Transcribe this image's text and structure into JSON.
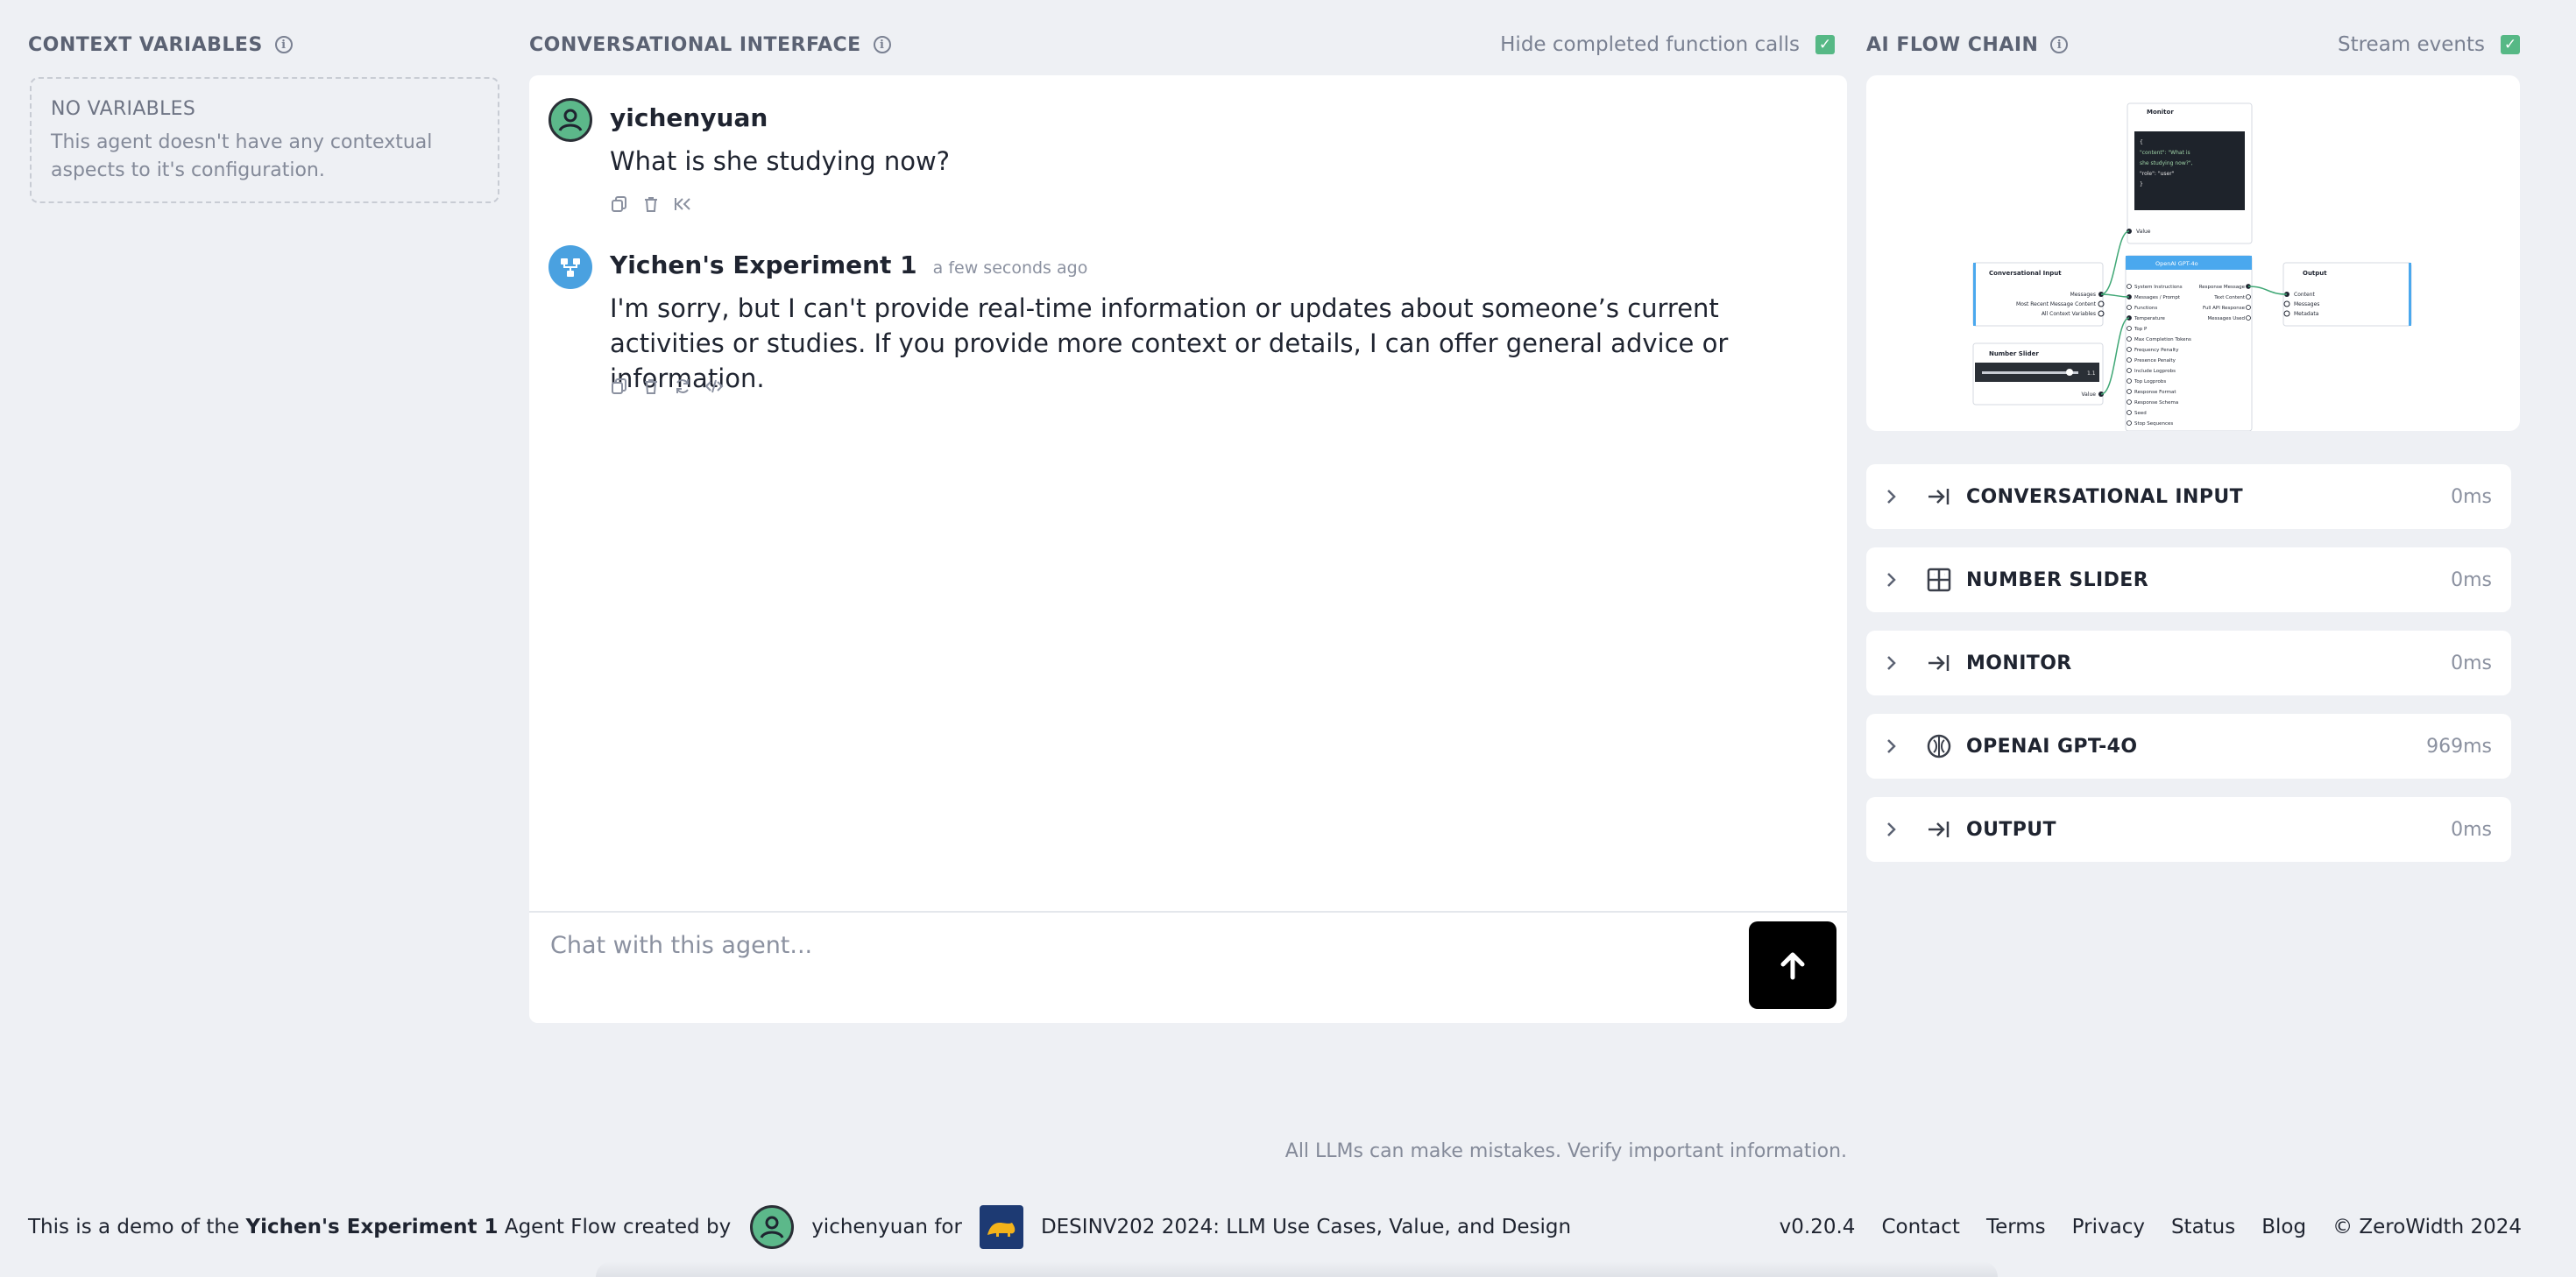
{
  "context": {
    "title": "CONTEXT VARIABLES",
    "empty_title": "NO VARIABLES",
    "empty_desc": "This agent doesn't have any contextual aspects to it's configuration."
  },
  "chat": {
    "title": "CONVERSATIONAL INTERFACE",
    "hide_completed_label": "Hide completed function calls",
    "messages": [
      {
        "author": "yichenyuan",
        "time": "",
        "text": "What is she studying now?"
      },
      {
        "author": "Yichen's Experiment 1",
        "time": "a few seconds ago",
        "text": "I'm sorry, but I can't provide real-time information or updates about someone’s current activities or studies. If you provide more context or details, I can offer general advice or information."
      }
    ],
    "input_placeholder": "Chat with this agent...",
    "disclaimer": "All LLMs can make mistakes. Verify important information."
  },
  "flow": {
    "title": "AI FLOW CHAIN",
    "stream_label": "Stream events",
    "preview": {
      "monitor": "Monitor",
      "monitor_code": [
        "{",
        "  \"content\": \"What is",
        "she studying now?\",",
        "  \"role\": \"user\"",
        "}"
      ],
      "value": "Value",
      "conv_input": "Conversational Input",
      "conv_outputs": [
        "Messages",
        "Most Recent Message Content",
        "All Context Variables"
      ],
      "slider": "Number Slider",
      "slider_value": "1.1",
      "slider_out": "Value",
      "openai": "OpenAI GPT-4o",
      "openai_inputs": [
        "System Instructions",
        "Messages / Prompt",
        "Functions",
        "Temperature",
        "Top P",
        "Max Completion Tokens",
        "Frequency Penalty",
        "Presence Penalty",
        "Include Logprobs",
        "Top Logprobs",
        "Response Format",
        "Response Schema",
        "Seed",
        "Stop Sequences"
      ],
      "openai_outputs": [
        "Response Message",
        "Text Content",
        "Full API Response",
        "Messages Used"
      ],
      "output": "Output",
      "output_inputs": [
        "Content",
        "Messages",
        "Metadata"
      ]
    },
    "steps": [
      {
        "label": "CONVERSATIONAL INPUT",
        "time": "0ms",
        "icon": "arrow-to-line-icon"
      },
      {
        "label": "NUMBER SLIDER",
        "time": "0ms",
        "icon": "grid-icon"
      },
      {
        "label": "MONITOR",
        "time": "0ms",
        "icon": "arrow-to-line-icon"
      },
      {
        "label": "OPENAI GPT-4O",
        "time": "969ms",
        "icon": "openai-icon"
      },
      {
        "label": "OUTPUT",
        "time": "0ms",
        "icon": "arrow-to-line-icon"
      }
    ]
  },
  "footer": {
    "prefix": "This is a demo of the",
    "agent_name": "Yichen's Experiment 1",
    "mid": "Agent Flow created by",
    "creator": "yichenyuan",
    "for": "for",
    "org": "DESINV202 2024: LLM Use Cases, Value, and Design",
    "version": "v0.20.4",
    "links": [
      "Contact",
      "Terms",
      "Privacy",
      "Status",
      "Blog"
    ],
    "copyright": "© ZeroWidth 2024"
  },
  "colors": {
    "accent_check": "#56b885",
    "send_button": "#000000",
    "agent_avatar": "#4aa1e0",
    "user_avatar": "#5cb88a",
    "openai_header": "#4aa8ee"
  }
}
